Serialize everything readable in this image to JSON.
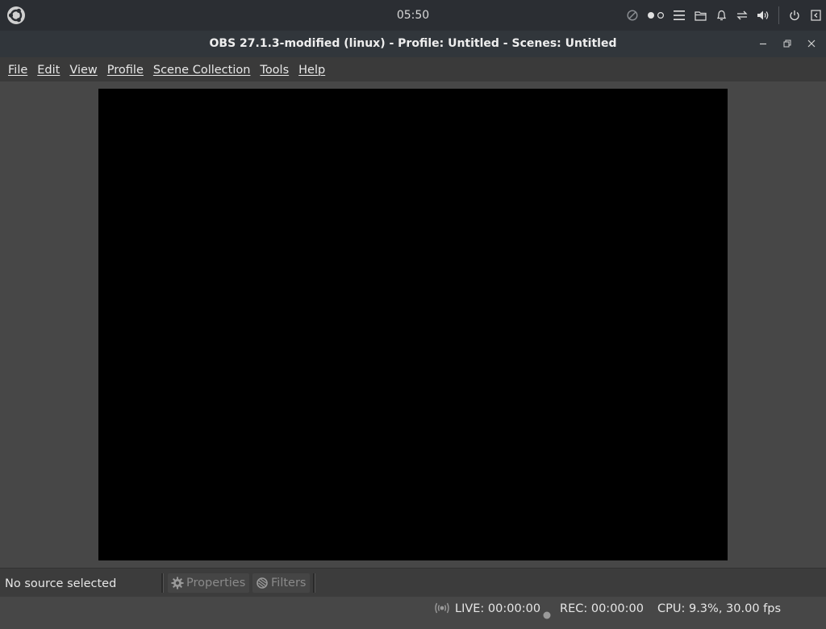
{
  "system_panel": {
    "clock": "05:50"
  },
  "window": {
    "title": "OBS 27.1.3-modified (linux) - Profile: Untitled - Scenes: Untitled"
  },
  "menu": {
    "items": [
      {
        "label": "File"
      },
      {
        "label": "Edit"
      },
      {
        "label": "View"
      },
      {
        "label": "Profile"
      },
      {
        "label": "Scene Collection"
      },
      {
        "label": "Tools"
      },
      {
        "label": "Help"
      }
    ]
  },
  "source_toolbar": {
    "no_source": "No source selected",
    "properties_label": "Properties",
    "filters_label": "Filters"
  },
  "status": {
    "live": "LIVE: 00:00:00",
    "rec": "REC: 00:00:00",
    "cpu": "CPU: 9.3%, 30.00 fps"
  },
  "icons": {
    "system_logo": "ubuntu-logo-icon",
    "tray": [
      "do-not-disturb-icon",
      "workspace-switcher-icon",
      "menu-icon",
      "folder-icon",
      "bell-icon",
      "network-icon",
      "volume-icon",
      "power-icon",
      "hide-panel-icon"
    ]
  },
  "colors": {
    "panel": "#2b2e33",
    "titlebar": "#31363b",
    "menubar": "#3a3a3a",
    "background": "#474747",
    "preview": "#000000",
    "rec_indicator": "#9a9a9a"
  }
}
